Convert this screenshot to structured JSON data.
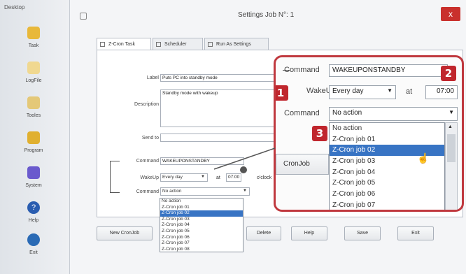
{
  "sidebar": {
    "title": "Desktop",
    "items": [
      {
        "label": "Task",
        "icon": "task-icon",
        "color": "#e8b83a"
      },
      {
        "label": "LogFile",
        "icon": "logfile-icon",
        "color": "#e8c260"
      },
      {
        "label": "Tooles",
        "icon": "tools-icon",
        "color": "#d8b050"
      },
      {
        "label": "Program",
        "icon": "program-icon",
        "color": "#e0b030"
      },
      {
        "label": "System",
        "icon": "system-icon",
        "color": "#6a5acd"
      },
      {
        "label": "Help",
        "icon": "help-icon",
        "color": "#2a5db0"
      },
      {
        "label": "Exit",
        "icon": "exit-icon",
        "color": "#2a6ab5"
      }
    ]
  },
  "window": {
    "title": "Settings Job N°: 1",
    "close_label": "x",
    "tabs": [
      {
        "label": "Z-Cron Task"
      },
      {
        "label": "Scheduler"
      },
      {
        "label": "Run As Settings"
      }
    ]
  },
  "form": {
    "label_label": "Label",
    "label_value": "Puts PC into standby mode",
    "description_label": "Description",
    "description_value": "Standby mode with wakeup",
    "send_to_label": "Send to",
    "command_label": "Command",
    "command_value": "WAKEUPONSTANDBY",
    "wakeup_label": "WakeUp",
    "wakeup_value": "Every day",
    "at_label": "at",
    "time_value": "07:00",
    "o_clock": "o'clock",
    "command2_label": "Command",
    "command2_value": "No action",
    "options": [
      "No action",
      "Z-Cron job 01",
      "Z-Cron job 02",
      "Z-Cron job 03",
      "Z-Cron job 04",
      "Z-Cron job 05",
      "Z-Cron job 06",
      "Z-Cron job 07",
      "Z-Cron job 08"
    ],
    "selected_option": "Z-Cron job 02",
    "cronjob_button": "CronJob"
  },
  "buttons": {
    "new_cronjob": "New CronJob",
    "delete": "Delete",
    "help": "Help",
    "save": "Save",
    "exit": "Exit"
  },
  "zoom": {
    "badges": [
      "1",
      "2",
      "3"
    ],
    "options": [
      "No action",
      "Z-Cron job 01",
      "Z-Cron job 02",
      "Z-Cron job 03",
      "Z-Cron job 04",
      "Z-Cron job 05",
      "Z-Cron job 06",
      "Z-Cron job 07"
    ]
  },
  "colors": {
    "accent": "#c0393f",
    "selection": "#3874c4",
    "close": "#c9302c"
  }
}
